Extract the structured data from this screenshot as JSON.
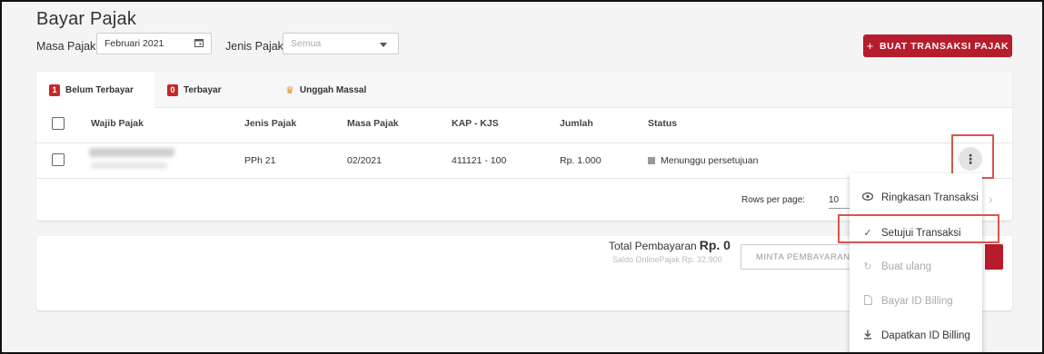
{
  "page": {
    "title": "Bayar Pajak"
  },
  "filters": {
    "masa_label": "Masa Pajak",
    "masa_value": "Februari 2021",
    "jenis_label": "Jenis Pajak",
    "jenis_placeholder": "Semua"
  },
  "actions": {
    "new_transaction": "BUAT TRANSAKSI PAJAK",
    "plus": "+"
  },
  "tabs": [
    {
      "badge": "1",
      "label": "Belum Terbayar",
      "active": true
    },
    {
      "badge": "0",
      "label": "Terbayar",
      "active": false
    },
    {
      "icon": "crown-icon",
      "glyph": "♛",
      "label": "Unggah Massal",
      "active": false
    }
  ],
  "table": {
    "headers": [
      "Wajib Pajak",
      "Jenis Pajak",
      "Masa Pajak",
      "KAP - KJS",
      "Jumlah",
      "Status"
    ],
    "rows": [
      {
        "wajib_pajak": "",
        "jenis_pajak": "PPh 21",
        "masa_pajak": "02/2021",
        "kap_kjs": "411121 - 100",
        "jumlah": "Rp. 1.000",
        "status": "Menunggu persetujuan"
      }
    ]
  },
  "pagination": {
    "rows_label": "Rows per page:",
    "rows_value": "10"
  },
  "summary": {
    "total_label": "Total Pembayaran",
    "total_value": "Rp. 0",
    "saldo": "Saldo OnlinePajak Rp. 32.900",
    "request_button": "MINTA PEMBAYARAN"
  },
  "context_menu": {
    "items": [
      {
        "label": "Ringkasan Transaksi",
        "icon": "eye-icon",
        "glyph": "👁",
        "enabled": true
      },
      {
        "label": "Setujui Transaksi",
        "icon": "check-icon",
        "glyph": "✓",
        "enabled": true
      },
      {
        "label": "Buat ulang",
        "icon": "refresh-icon",
        "glyph": "↻",
        "enabled": false
      },
      {
        "label": "Bayar ID Billing",
        "icon": "document-icon",
        "glyph": "🗋",
        "enabled": false
      },
      {
        "label": "Dapatkan ID Billing",
        "icon": "download-icon",
        "glyph": "⤓",
        "enabled": true
      }
    ]
  },
  "colors": {
    "brand_red": "#b71c2c",
    "highlight_box": "#d9534f"
  }
}
